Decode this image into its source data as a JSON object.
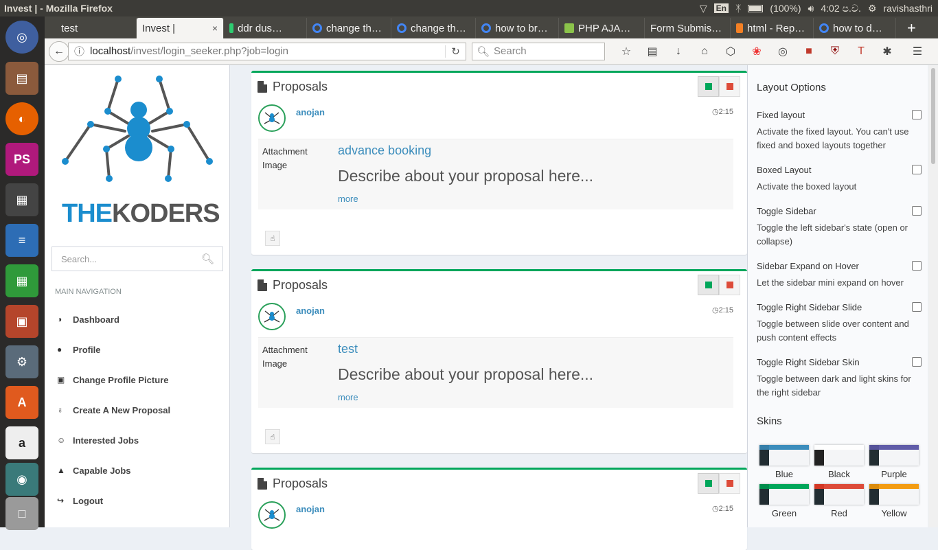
{
  "system": {
    "window_title": "Invest | - Mozilla Firefox",
    "lang": "En",
    "battery": "(100%)",
    "clock": "4:02 ප.ව.",
    "user": "ravishasthri"
  },
  "browser": {
    "tabs": [
      {
        "label": "test",
        "color": "#474641"
      },
      {
        "label": "Invest |",
        "color": "#f5f4f2"
      },
      {
        "label": "ddr dus…",
        "color": "#2ecc71"
      },
      {
        "label": "change th…",
        "color": "#4285f4"
      },
      {
        "label": "change th…",
        "color": "#4285f4"
      },
      {
        "label": "how to br…",
        "color": "#4285f4"
      },
      {
        "label": "PHP AJA…",
        "color": "#8bc34a"
      },
      {
        "label": "Form Submis…",
        "color": "#474641"
      },
      {
        "label": "html - Rep…",
        "color": "#f48024"
      },
      {
        "label": "how to d…",
        "color": "#4285f4"
      }
    ],
    "tab_close": "×",
    "new_tab": "+",
    "url_host": "localhost",
    "url_path": "/invest/login_seeker.php?job=login",
    "search_placeholder": "Search"
  },
  "brand": {
    "name_a": "THE",
    "name_b": "KODERS"
  },
  "sidebar": {
    "search_placeholder": "Search...",
    "header": "MAIN NAVIGATION",
    "items": [
      {
        "label": "Dashboard",
        "icon": "dashboard-icon"
      },
      {
        "label": "Profile",
        "icon": "user-icon"
      },
      {
        "label": "Change Profile Picture",
        "icon": "picture-icon"
      },
      {
        "label": "Create A New Proposal",
        "icon": "lightbulb-icon"
      },
      {
        "label": "Interested Jobs",
        "icon": "smile-icon"
      },
      {
        "label": "Capable Jobs",
        "icon": "graduation-cap-icon"
      },
      {
        "label": "Logout",
        "icon": "sign-out-icon"
      }
    ]
  },
  "proposals": [
    {
      "header": "Proposals",
      "user": "anojan",
      "time": "2:15",
      "attachment_label": "Attachment Image",
      "title": "advance booking",
      "description": "Describe about your proposal here...",
      "more": "more"
    },
    {
      "header": "Proposals",
      "user": "anojan",
      "time": "2:15",
      "attachment_label": "Attachment Image",
      "title": "test",
      "description": "Describe about your proposal here...",
      "more": "more"
    },
    {
      "header": "Proposals",
      "user": "anojan",
      "time": "2:15"
    }
  ],
  "control_sidebar": {
    "title": "Layout Options",
    "options": [
      {
        "label": "Fixed layout",
        "desc": "Activate the fixed layout. You can't use fixed and boxed layouts together",
        "checked": false
      },
      {
        "label": "Boxed Layout",
        "desc": "Activate the boxed layout",
        "checked": false
      },
      {
        "label": "Toggle Sidebar",
        "desc": "Toggle the left sidebar's state (open or collapse)",
        "checked": false
      },
      {
        "label": "Sidebar Expand on Hover",
        "desc": "Let the sidebar mini expand on hover",
        "checked": false
      },
      {
        "label": "Toggle Right Sidebar Slide",
        "desc": "Toggle between slide over content and push content effects",
        "checked": false
      },
      {
        "label": "Toggle Right Sidebar Skin",
        "desc": "Toggle between dark and light skins for the right sidebar",
        "checked": false
      }
    ],
    "skins_title": "Skins",
    "skins": [
      {
        "label": "Blue",
        "color": "#367fa9",
        "light": "#3c8dbc"
      },
      {
        "label": "Black",
        "color": "#fefefe",
        "light": "#fefefe"
      },
      {
        "label": "Purple",
        "color": "#555299",
        "light": "#605ca8"
      },
      {
        "label": "Green",
        "color": "#008d4c",
        "light": "#00a65a"
      },
      {
        "label": "Red",
        "color": "#dd4b39",
        "light": "#d33724"
      },
      {
        "label": "Yellow",
        "color": "#f39c12",
        "light": "#db8b0b"
      }
    ]
  },
  "colors": {
    "accent": "#3c8dbc",
    "box_border": "#00a65a",
    "danger": "#dd4b39"
  }
}
